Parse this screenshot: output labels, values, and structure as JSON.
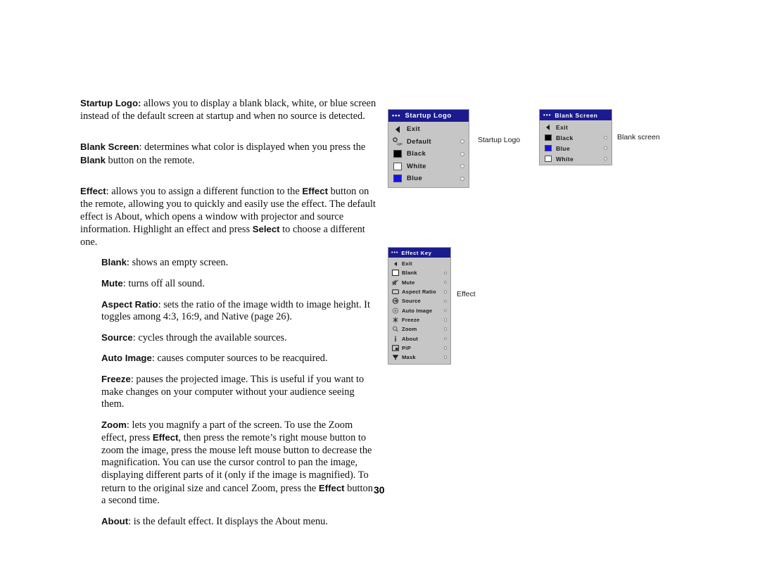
{
  "page": {
    "number": "30"
  },
  "body_text": {
    "p_startup_logo": {
      "term": "Startup Logo:",
      "rest": " allows you to display a blank black, white, or blue screen instead of the default screen at startup and when no source is detected."
    },
    "p_blank_screen": {
      "seg1_bold": "Blank Screen",
      "seg2": ": determines what color is displayed when you press the ",
      "seg3_bold": "Blank",
      "seg4": " button on the remote."
    },
    "p_effect": {
      "seg1_bold": "Effect",
      "seg2": ": allows you to assign a different function to the ",
      "seg3_bold": "Effect",
      "seg4": " button on the remote, allowing you to quickly and easily use the effect. The default effect is About, which opens a window with projector and source information. Highlight an effect and press ",
      "seg5_bold": "Select",
      "seg6": " to choose a different one."
    },
    "p_blank": {
      "term": "Blank",
      "rest": ": shows an empty screen."
    },
    "p_mute": {
      "term": "Mute",
      "rest": ": turns off all sound."
    },
    "p_aspect_ratio": {
      "term": "Aspect Ratio",
      "rest": ": sets the ratio of the image width to image height. It toggles among 4:3, 16:9, and Native (page 26)."
    },
    "p_source": {
      "term": "Source",
      "rest": ": cycles through the available sources."
    },
    "p_auto_image": {
      "term": "Auto Image",
      "rest": ": causes computer sources to be reacquired."
    },
    "p_freeze": {
      "term": "Freeze",
      "rest": ": pauses the projected image. This is useful if you want to make changes on your computer without your audience seeing them."
    },
    "p_zoom": {
      "seg1_bold": "Zoom",
      "seg2": ": lets you magnify a part of the screen. To use the Zoom effect, press ",
      "seg3_bold": "Effect",
      "seg4": ", then press the remote’s right mouse button to zoom the image, press the mouse left mouse button to decrease the magnification. You can use the cursor control to pan the image, displaying different parts of it (only if the image is magnified). To return to the original size and cancel Zoom, press the ",
      "seg5_bold": "Effect",
      "seg6": " button a second time."
    },
    "p_about": {
      "term": "About",
      "rest": ": is the default effect. It displays the About menu."
    }
  },
  "colors": {
    "title_bar": "#1b1b8f",
    "menu_body": "#c6c6c6",
    "swatch_black": "#000000",
    "swatch_white": "#ffffff",
    "swatch_blue": "#1414e6"
  },
  "menus": [
    {
      "id": "startup-logo",
      "title": "Startup Logo",
      "dots": "•••",
      "caption": "Startup Logo",
      "items": [
        {
          "label": "Exit",
          "icon": "back-arrow-icon",
          "radio": false
        },
        {
          "label": "Default",
          "icon": "default-logo-icon",
          "radio": true
        },
        {
          "label": "Black",
          "icon": "swatch-black-icon",
          "radio": true
        },
        {
          "label": "White",
          "icon": "swatch-white-icon",
          "radio": true
        },
        {
          "label": "Blue",
          "icon": "swatch-blue-icon",
          "radio": true
        }
      ]
    },
    {
      "id": "blank-screen",
      "title": "Blank Screen",
      "dots": "•••",
      "caption": "Blank screen",
      "items": [
        {
          "label": "Exit",
          "icon": "back-arrow-icon",
          "radio": false
        },
        {
          "label": "Black",
          "icon": "swatch-black-icon",
          "radio": true
        },
        {
          "label": "Blue",
          "icon": "swatch-blue-icon",
          "radio": true
        },
        {
          "label": "White",
          "icon": "swatch-white-icon",
          "radio": true
        }
      ]
    },
    {
      "id": "effect-key",
      "title": "Effect Key",
      "dots": "•••",
      "caption": "Effect",
      "items": [
        {
          "label": "Exit",
          "icon": "back-arrow-icon",
          "radio": false
        },
        {
          "label": "Blank",
          "icon": "blank-screen-icon",
          "radio": true
        },
        {
          "label": "Mute",
          "icon": "mute-speaker-icon",
          "radio": true
        },
        {
          "label": "Aspect Ratio",
          "icon": "aspect-ratio-icon",
          "radio": true
        },
        {
          "label": "Source",
          "icon": "source-icon",
          "radio": true
        },
        {
          "label": "Auto Image",
          "icon": "auto-image-icon",
          "radio": true
        },
        {
          "label": "Freeze",
          "icon": "freeze-snowflake-icon",
          "radio": true
        },
        {
          "label": "Zoom",
          "icon": "zoom-magnifier-icon",
          "radio": true
        },
        {
          "label": "About",
          "icon": "info-icon",
          "radio": true
        },
        {
          "label": "PiP",
          "icon": "pip-icon",
          "radio": true
        },
        {
          "label": "Mask",
          "icon": "mask-icon",
          "radio": true
        }
      ]
    }
  ]
}
